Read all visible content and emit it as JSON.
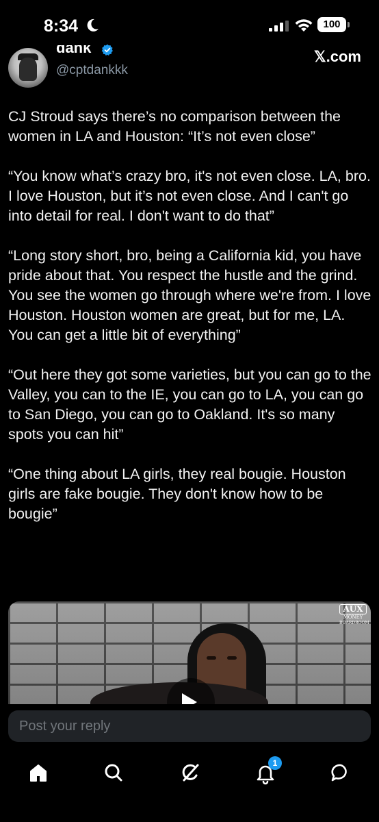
{
  "status_bar": {
    "time": "8:34",
    "battery_level": "100",
    "dnd": "moon-icon",
    "signal": "signal-icon",
    "wifi": "wifi-icon"
  },
  "post": {
    "author": {
      "display_name": "dank",
      "handle": "@cptdankkk",
      "verified": true
    },
    "source": "𝕏.com",
    "paragraphs": [
      "CJ Stroud says there’s no comparison between the women in LA and Houston: “It’s not even close”",
      "“You know what’s crazy bro, it's not even close. LA, bro. I love Houston, but it’s not even close. And I can't go into detail for real. I don't want to do that”",
      "“Long story short, bro, being a California kid, you have pride about that. You respect the hustle and the grind. You see the women go through where we're from. I love Houston. Houston women are great, but for me, LA. You can get a little bit of everything”",
      "“Out here they got some varieties, but you can go to the Valley, you can to the IE, you can go to LA, you can go to San Diego, you can go to Oakland. It's so many spots you can hit”",
      "“One thing about LA girls, they real bougie. Houston girls are fake bougie. They don't know how to be bougie”"
    ],
    "media": {
      "watermark_line1": "AUX",
      "watermark_line2": "MONEY",
      "watermark_line3": "BOARDROOM"
    }
  },
  "reply": {
    "placeholder": "Post your reply"
  },
  "tab_bar": {
    "items": [
      {
        "name": "home",
        "icon": "home-icon"
      },
      {
        "name": "search",
        "icon": "search-icon"
      },
      {
        "name": "grok",
        "icon": "grok-icon"
      },
      {
        "name": "notifications",
        "icon": "bell-icon",
        "badge": "1"
      },
      {
        "name": "messages",
        "icon": "message-icon"
      }
    ]
  },
  "colors": {
    "background": "#000000",
    "accent": "#1d9bf0",
    "secondary_text": "#8b98a5",
    "reply_bar": "#202327"
  }
}
